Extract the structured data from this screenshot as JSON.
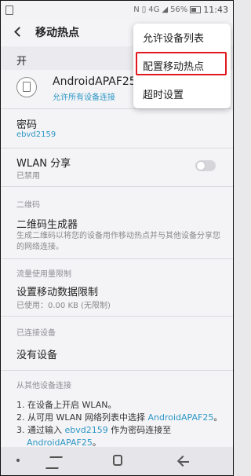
{
  "header": {
    "title": "移动热点"
  },
  "status_bar": {
    "battery": "56%",
    "time": "11:43",
    "network": "4G"
  },
  "master": {
    "label": "开"
  },
  "network": {
    "name": "AndroidAPAF25",
    "sub": "允许所有设备连接"
  },
  "password": {
    "title": "密码",
    "value": "ebvd2159"
  },
  "wlan_share": {
    "title": "WLAN 分享",
    "sub": "已禁用"
  },
  "sections": {
    "qr": "二维码",
    "usage": "流量使用量限制",
    "connected": "已连接设备",
    "other": "从其他设备连接"
  },
  "qr_generator": {
    "title": "二维码生成器",
    "sub": "生成二维码以将您的设备用作移动热点并与其他设备分享您的网络连接。"
  },
  "data_limit": {
    "title": "设置移动数据限制",
    "sub": "已使用：0.00 KB (无限制)"
  },
  "no_devices": "没有设备",
  "instructions": {
    "step1": "1. 在设备上开启 WLAN。",
    "step2_prefix": "2. 从可用 WLAN 网络列表中选择 ",
    "step2_link": "AndroidAPAF25",
    "step2_suffix": "。",
    "step3_prefix": "3. 通过输入 ",
    "step3_pw": "ebvd2159",
    "step3_mid": " 作为密码连接至",
    "step3_link": "AndroidAPAF25",
    "step3_suffix": "。"
  },
  "popup": {
    "items": [
      "允许设备列表",
      "配置移动热点",
      "超时设置"
    ],
    "highlighted_index": 1
  },
  "colors": {
    "accent": "#2e97c6",
    "highlight": "#e0191f"
  }
}
